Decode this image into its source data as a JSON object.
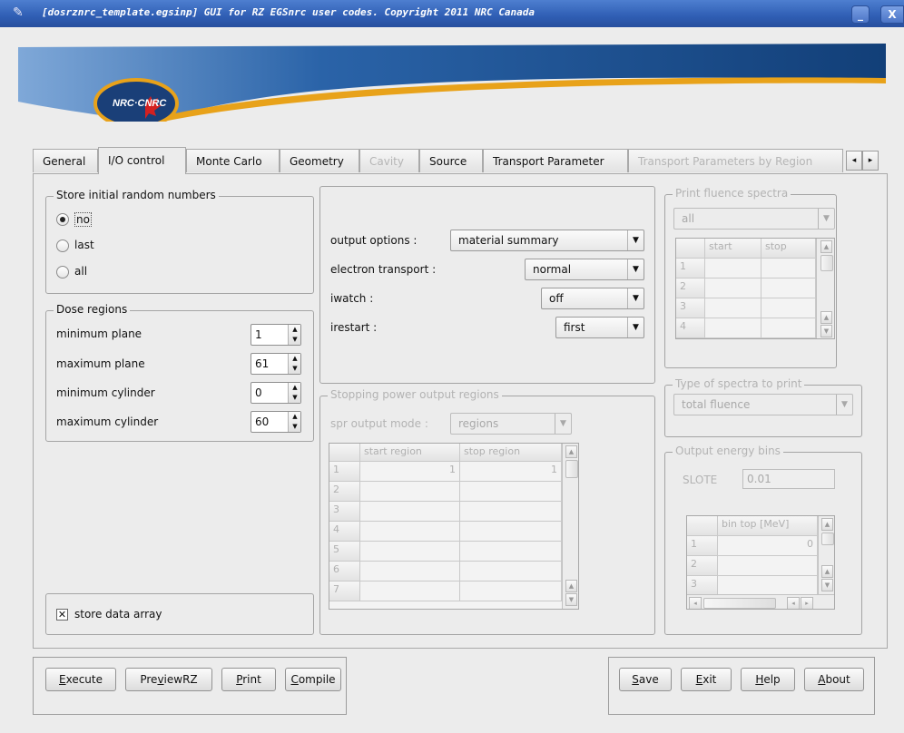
{
  "window": {
    "title": "[dosrznrc_template.egsinp] GUI for RZ EGSnrc user codes. Copyright 2011 NRC Canada",
    "minimize": "_",
    "close": "X"
  },
  "banner": {
    "logo_text": "NRC·CNRC"
  },
  "tabs": [
    {
      "label": "General"
    },
    {
      "label": "I/O control"
    },
    {
      "label": "Monte Carlo"
    },
    {
      "label": "Geometry"
    },
    {
      "label": "Cavity"
    },
    {
      "label": "Source"
    },
    {
      "label": "Transport Parameter"
    },
    {
      "label": "Transport Parameters by Region"
    }
  ],
  "tab_scroll": {
    "left": "◂",
    "right": "▸"
  },
  "random_numbers": {
    "title": "Store initial random numbers",
    "options": [
      {
        "label": "no",
        "selected": true
      },
      {
        "label": "last",
        "selected": false
      },
      {
        "label": "all",
        "selected": false
      }
    ]
  },
  "dose_regions": {
    "title": "Dose regions",
    "rows": [
      {
        "label": "minimum plane",
        "value": "1"
      },
      {
        "label": "maximum plane",
        "value": "61"
      },
      {
        "label": "minimum cylinder",
        "value": "0"
      },
      {
        "label": "maximum cylinder",
        "value": "60"
      }
    ]
  },
  "store_data_array": {
    "label": "store data array",
    "checked": true,
    "mark": "✕"
  },
  "options": {
    "rows": [
      {
        "label": "output options :",
        "value": "material summary"
      },
      {
        "label": "electron transport :",
        "value": "normal"
      },
      {
        "label": "iwatch :",
        "value": "off"
      },
      {
        "label": "irestart :",
        "value": "first"
      }
    ]
  },
  "spr": {
    "title": "Stopping power output regions",
    "mode_label": "spr output mode :",
    "mode_value": "regions",
    "columns": [
      "start region",
      "stop region"
    ],
    "rows": [
      {
        "n": "1",
        "start": "1",
        "stop": "1"
      },
      {
        "n": "2",
        "start": "",
        "stop": ""
      },
      {
        "n": "3",
        "start": "",
        "stop": ""
      },
      {
        "n": "4",
        "start": "",
        "stop": ""
      },
      {
        "n": "5",
        "start": "",
        "stop": ""
      },
      {
        "n": "6",
        "start": "",
        "stop": ""
      },
      {
        "n": "7",
        "start": "",
        "stop": ""
      }
    ]
  },
  "fluence": {
    "title": "Print fluence spectra",
    "value": "all",
    "columns": [
      "start",
      "stop"
    ],
    "rows": [
      "1",
      "2",
      "3",
      "4"
    ]
  },
  "spectra_type": {
    "title": "Type of spectra to print",
    "value": "total fluence"
  },
  "energy_bins": {
    "title": "Output energy bins",
    "slote_label": "SLOTE",
    "slote_value": "0.01",
    "column": "bin top [MeV]",
    "rows": [
      {
        "n": "1",
        "value": "0"
      },
      {
        "n": "2",
        "value": ""
      },
      {
        "n": "3",
        "value": ""
      }
    ]
  },
  "bottom_left_buttons": [
    {
      "pre": "",
      "key": "E",
      "post": "xecute"
    },
    {
      "pre": "Pre",
      "key": "v",
      "post": "iewRZ"
    },
    {
      "pre": "",
      "key": "P",
      "post": "rint"
    },
    {
      "pre": "",
      "key": "C",
      "post": "ompile"
    }
  ],
  "bottom_right_buttons": [
    {
      "pre": "",
      "key": "S",
      "post": "ave"
    },
    {
      "pre": "",
      "key": "E",
      "post": "xit"
    },
    {
      "pre": "",
      "key": "H",
      "post": "elp"
    },
    {
      "pre": "",
      "key": "A",
      "post": "bout"
    }
  ],
  "colors": {
    "titlebar": "#2f5eb4",
    "banner_blue": "#1b4d8c",
    "banner_accent": "#e8a21a"
  }
}
